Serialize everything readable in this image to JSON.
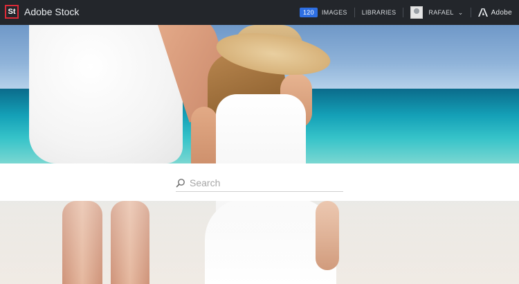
{
  "app": {
    "logo_text": "St",
    "brand": "Adobe Stock"
  },
  "nav": {
    "image_count": "120",
    "images_label": "IMAGES",
    "libraries_label": "LIBRARIES",
    "user_name": "RAFAEL",
    "adobe_label": "Adobe"
  },
  "search": {
    "placeholder": "Search"
  },
  "colors": {
    "accent": "#2e6fe3",
    "logo": "#da2a37",
    "topbar": "#23262b"
  },
  "icons": [
    "search-icon",
    "chevron-down-icon",
    "avatar",
    "adobe-logo-icon"
  ]
}
